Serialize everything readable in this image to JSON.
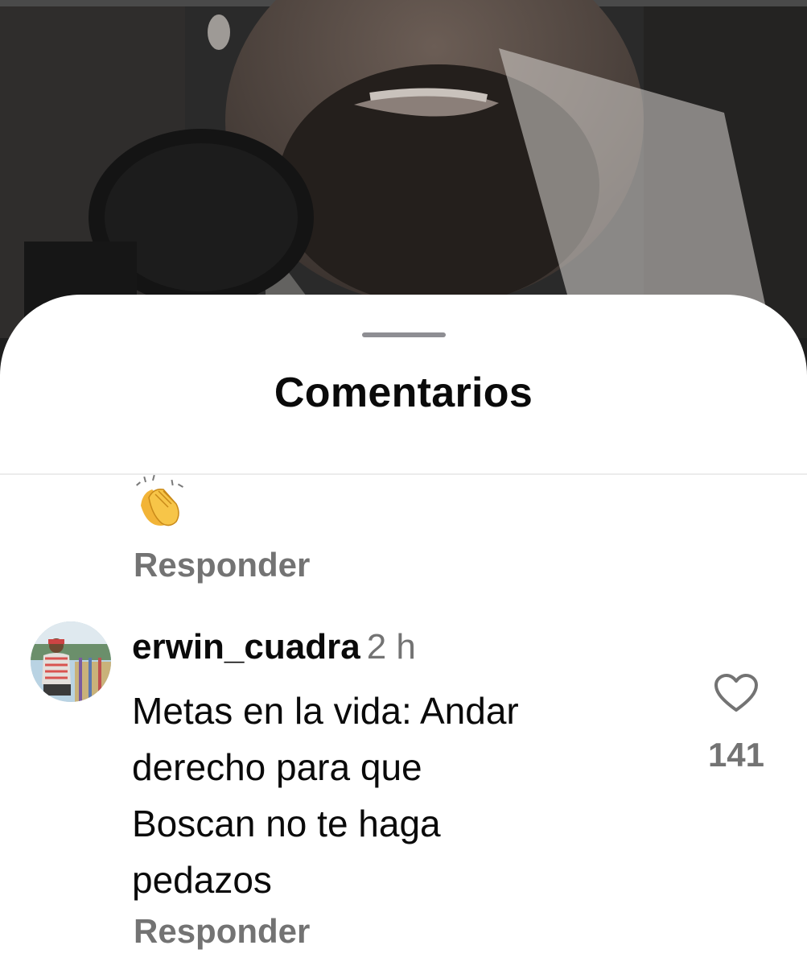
{
  "sheet": {
    "title": "Comentarios"
  },
  "previous_comment": {
    "emoji": "👏",
    "reply_label": "Responder"
  },
  "comment": {
    "username": "erwin_cuadra",
    "time": "2 h",
    "lines": [
      "Metas en la vida: Andar",
      "derecho para que",
      "Boscan no te haga",
      "pedazos"
    ],
    "likes": "141",
    "reply_label": "Responder"
  },
  "icons": {
    "like": "heart-outline-icon",
    "grabber": "sheet-grabber"
  },
  "colors": {
    "text_primary": "#0a0a0a",
    "text_secondary": "#737373",
    "sheet_bg": "#ffffff"
  }
}
